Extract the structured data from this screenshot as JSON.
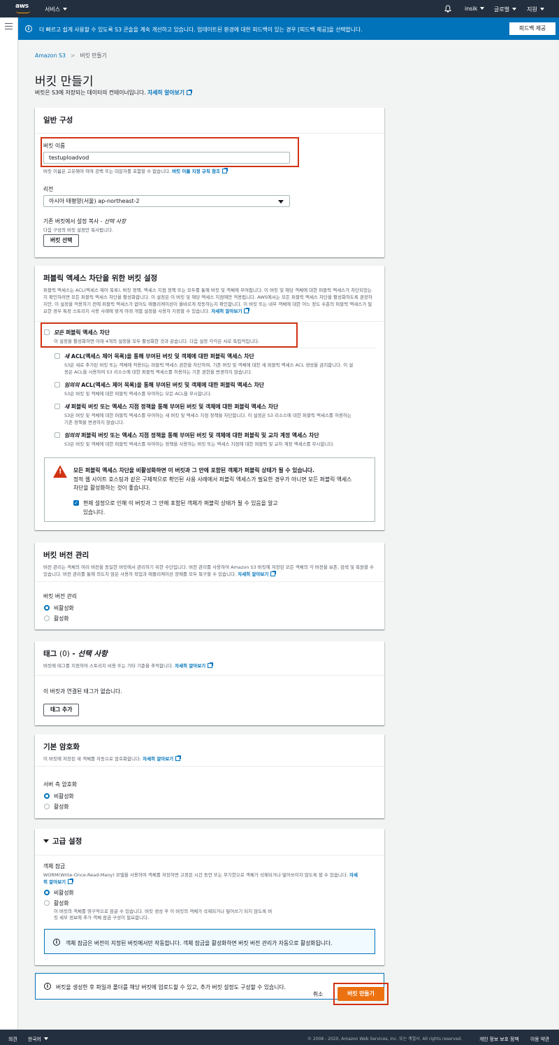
{
  "nav": {
    "logo": "aws",
    "services": "서비스",
    "user": "insik",
    "region": "글로벌",
    "support": "지원"
  },
  "flash": {
    "icon": "info-icon",
    "text": "더 빠르고 쉽게 사용할 수 있도록 S3 콘솔을 계속 개선하고 있습니다. 업데이트된 환경에 대한 피드백이 있는 경우 [피드백 제공]을 선택합니다.",
    "button": "피드백 제공"
  },
  "breadcrumb": {
    "root": "Amazon S3",
    "current": "버킷 만들기"
  },
  "page": {
    "title": "버킷 만들기",
    "subtitle": "버킷은 S3에 저장되는 데이터의 컨테이너입니다.",
    "learn_more": "자세히 알아보기"
  },
  "general": {
    "title": "일반 구성",
    "bucket_name_label": "버킷 이름",
    "bucket_name_value": "testuploadvod",
    "bucket_name_hint": "버킷 이름은 고유해야 하며 공백 또는 대문자를 포함할 수 없습니다.",
    "bucket_name_rules": "버킷 이름 지정 규칙 참조",
    "region_label": "리전",
    "region_value": "아시아 태평양(서울) ap-northeast-2",
    "copy_label": "기존 버킷에서 설정 복사 -",
    "copy_optional": "선택 사항",
    "copy_desc": "다음 구성의 버킷 설정만 복사됩니다.",
    "choose_bucket": "버킷 선택"
  },
  "public": {
    "title": "퍼블릭 액세스 차단을 위한 버킷 설정",
    "desc": "퍼블릭 액세스는 ACL(액세스 제어 목록), 버킷 정책, 액세스 지점 정책 또는 모두를 통해 버킷 및 객체에 부여됩니다. 이 버킷 및 해당 객체에 대한 퍼블릭 액세스가 차단되었는지 확인하려면 모든 퍼블릭 액세스 차단을 활성화합니다. 이 설정은 이 버킷 및 해당 액세스 지점에만 적용됩니다. AWS에서는 모든 퍼블릭 액세스 차단을 활성화하도록 권장하지만, 이 설정을 적용하기 전에 퍼블릭 액세스가 없어도 애플리케이션이 올바르게 작동하는지 확인합니다. 이 버킷 또는 내부 객체에 대한 어느 정도 수준의 퍼블릭 액세스가 필요한 경우 특정 스토리지 사용 사례에 맞게 아래 개별 설정을 사용자 지정할 수 있습니다.",
    "learn_more": "자세히 알아보기",
    "all_em": "모든",
    "all_label": "퍼블릭 액세스 차단",
    "all_desc": "이 설정을 활성화하면 아래 4개의 설정을 모두 활성화한 것과 같습니다. 다음 설정 각각은 서로 독립적입니다.",
    "opts": [
      {
        "em": "새",
        "label": "ACL(액세스 제어 목록)을 통해 부여된 버킷 및 객체에 대한 퍼블릭 액세스 차단",
        "d1": "S3은 새로 추가된 버킷 또는 객체에 적용되는 퍼블릭 액세스 권한을 차단하며, 기존 버킷 및 객체에 대한 새 퍼블릭 액세스 ACL 생성을 금지합니다. 이 설",
        "d2": "정은 ACL을 사용하여 S3 리소스에 대한 퍼블릭 액세스를 허용하는 기존 권한을 변경하지 않습니다."
      },
      {
        "em": "임의의",
        "label": "ACL(액세스 제어 목록)을 통해 부여된 버킷 및 객체에 대한 퍼블릭 액세스 차단",
        "d1": "S3은 버킷 및 객체에 대한 퍼블릭 액세스를 부여하는 모든 ACL을 무시합니다.",
        "d2": ""
      },
      {
        "em": "새",
        "label": "퍼블릭 버킷 또는 액세스 지점 정책을 통해 부여된 버킷 및 객체에 대한 퍼블릭 액세스 차단",
        "d1": "S3은 버킷 및 객체에 대한 퍼블릭 액세스를 부여하는 새 버킷 및 액세스 지점 정책을 차단합니다. 이 설정은 S3 리소스에 대한 퍼블릭 액세스를 허용하는",
        "d2": "기존 정책을 변경하지 않습니다."
      },
      {
        "em": "임의의",
        "label": "퍼블릭 버킷 또는 액세스 지점 정책을 통해 부여된 버킷 및 객체에 대한 퍼블릭 및 교차 계정 액세스 차단",
        "d1": "S3은 버킷 및 객체에 대한 퍼블릭 액세스를 부여하는 정책을 사용하는 버킷 또는 액세스 지점에 대한 퍼블릭 및 교차 계정 액세스를 무시합니다.",
        "d2": ""
      }
    ],
    "warn_title": "모든 퍼블릭 액세스 차단을 비활성화하면 이 버킷과 그 안에 포함된 객체가 퍼블릭 상태가 될 수 있습니다.",
    "warn_l1": "정적 웹 사이트 호스팅과 같은 구체적으로 확인된 사용 사례에서 퍼블릭 액세스가 필요한 경우가 아니면 모든 퍼블릭 액세스",
    "warn_l2": "차단을 활성화하는 것이 좋습니다.",
    "ack_l1": "현재 설정으로 인해 이 버킷과 그 안에 포함된 객체가 퍼블릭 상태가 될 수 있음을 알고",
    "ack_l2": "있습니다."
  },
  "versioning": {
    "title": "버킷 버전 관리",
    "desc": "버전 관리는 객체의 여러 버전을 동일한 버킷에서 관리하기 위한 수단입니다. 버전 관리를 사용하여 Amazon S3 버킷에 저장된 모든 객체의 각 버전을 보존, 검색 및 복원할 수 있습니다. 버전 관리를 통해 의도치 않은 사용자 작업과 애플리케이션 장애를 모두 복구할 수 있습니다.",
    "learn_more": "자세히 알아보기",
    "label": "버킷 버전 관리",
    "off": "비활성화",
    "on": "활성화"
  },
  "tags": {
    "title": "태그",
    "count": "(0)",
    "optional": "- 선택 사항",
    "desc": "버킷에 태그를 지정하여 스토리지 비용 또는 기타 기준을 추적합니다.",
    "learn_more": "자세히 알아보기",
    "empty": "이 버킷과 연결된 태그가 없습니다.",
    "add": "태그 추가"
  },
  "encryption": {
    "title": "기본 암호화",
    "desc": "이 버킷에 저장된 새 객체를 자동으로 암호화합니다.",
    "learn_more": "자세히 알아보기",
    "label": "서버 측 암호화",
    "off": "비활성화",
    "on": "활성화"
  },
  "advanced": {
    "title": "고급 설정",
    "lock_label": "객체 잠금",
    "lock_desc": "WORM(Write-Once-Read-Many) 모델을 사용하여 객체를 저장하면 고정된 시간 동안 또는 무기한으로 객체가 삭제되거나 덮어쓰이지 않도록 할 수 있습니다.",
    "learn1": "자세",
    "learn2": "히 알아보기",
    "off": "비활성화",
    "on": "활성화",
    "on_d1": "이 버킷의 객체를 영구적으로 잠글 수 있습니다. 버킷 생성 후 이 버킷의 객체가 삭제되거나 덮어쓰기 되지 않도록 버",
    "on_d2": "킷 세부 정보에 추가 객체 잠금 구성이 필요합니다.",
    "info": "객체 잠금은 버전이 지정된 버킷에서만 작동합니다. 객체 잠금을 활성화하면 버킷 버전 관리가 자동으로 활성화됩니다."
  },
  "bottom_info": "버킷을 생성한 후 파일과 폴더를 해당 버킷에 업로드할 수 있고, 추가 버킷 설정도 구성할 수 있습니다.",
  "actions": {
    "cancel": "취소",
    "create": "버킷 만들기"
  },
  "footer": {
    "feedback": "의견",
    "language": "한국어",
    "copyright": "© 2008 - 2020, Amazon Web Services, Inc. 또는 계열사. All rights reserved.",
    "privacy": "개인 정보 보호 정책",
    "terms": "이용 약관"
  },
  "colors": {
    "nav": "#232f3e",
    "flash": "#0073bb",
    "primary": "#ec7211",
    "highlight": "#d13212"
  }
}
